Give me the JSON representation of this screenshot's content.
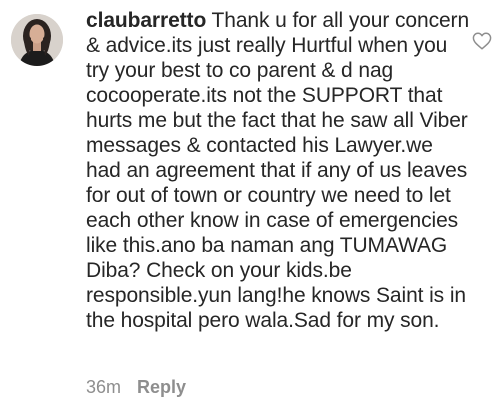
{
  "comment": {
    "username": "claubarretto",
    "text": "Thank u for all your concern & advice.its just really Hurtful when you try your best to co parent & d nag cocooperate.its not the SUPPORT that hurts me but the fact that he saw all Viber messages & contacted his Lawyer.we had an agreement that if any of us leaves for out of town or country we need to let each other know in case of emergencies like this.ano ba naman ang TUMAWAG Diba? Check on your kids.be responsible.yun lang!he knows Saint is in the hospital pero wala.Sad for my son.",
    "timestamp": "36m",
    "reply_label": "Reply"
  },
  "icons": {
    "like": "heart-outline-icon",
    "avatar": "profile-photo"
  },
  "colors": {
    "text": "#262626",
    "secondary": "#8e8e8e"
  }
}
